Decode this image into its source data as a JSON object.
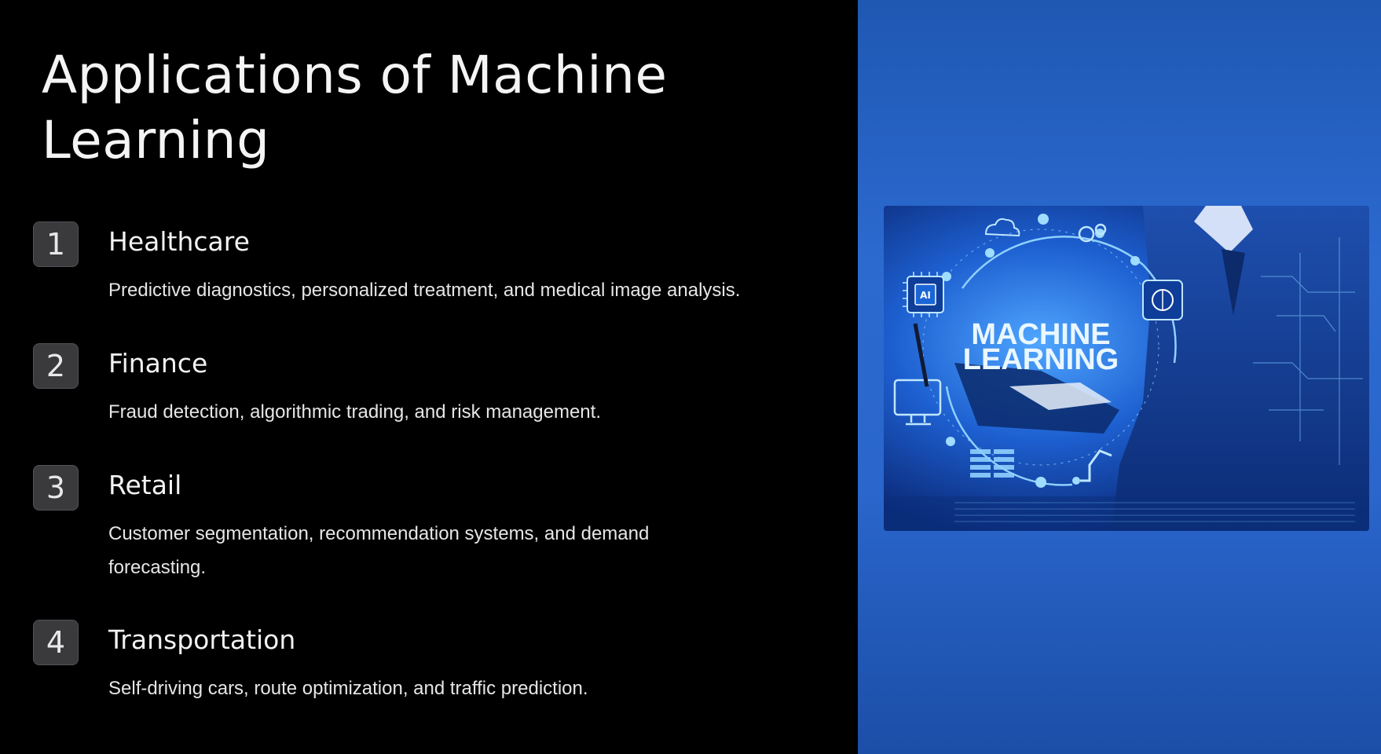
{
  "slide": {
    "title_line1": "Applications of Machine",
    "title_line2": "Learning"
  },
  "items": [
    {
      "number": "1",
      "title": "Healthcare",
      "description": "Predictive diagnostics, personalized treatment, and medical image analysis."
    },
    {
      "number": "2",
      "title": "Finance",
      "description": "Fraud detection, algorithmic trading, and risk management."
    },
    {
      "number": "3",
      "title": "Retail",
      "description": "Customer segmentation, recommendation systems, and demand forecasting."
    },
    {
      "number": "4",
      "title": "Transportation",
      "description": "Self-driving cars, route optimization, and traffic prediction."
    }
  ],
  "image": {
    "text_line1": "MACHINE",
    "text_line2": "LEARNING",
    "chip_label": "AI"
  },
  "colors": {
    "background": "#000000",
    "badge": "#3a3a3d",
    "right_panel": "#2a66cc",
    "accent_text": "#e8f6ff"
  }
}
